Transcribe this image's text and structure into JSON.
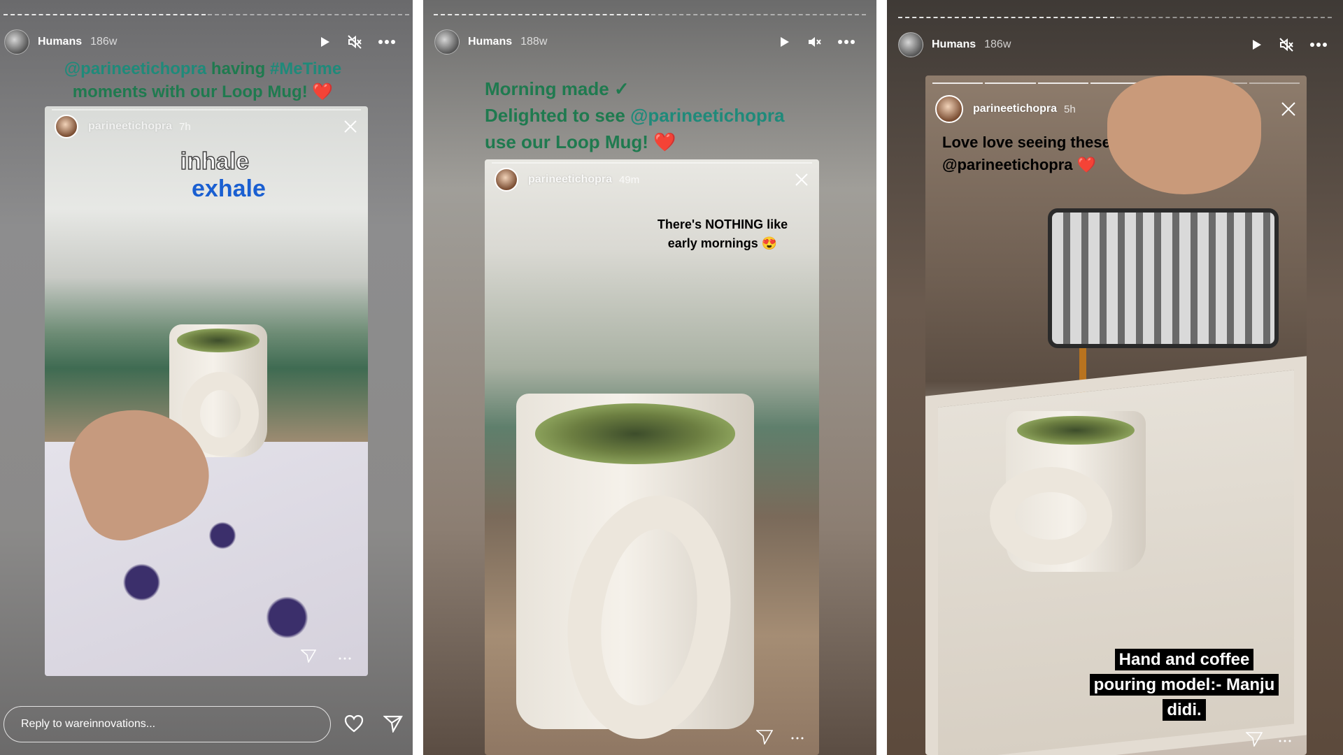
{
  "stories": [
    {
      "header": {
        "name": "Humans",
        "time": "186w"
      },
      "caption": {
        "mention": "@parineetichopra",
        "text1": " having ",
        "hashtag": "#MeTime",
        "line2": "moments with our Loop Mug! ❤️"
      },
      "card": {
        "username": "parineetichopra",
        "time": "7h",
        "sticker_top": "inhale",
        "sticker_bottom": "exhale"
      },
      "reply": {
        "placeholder": "Reply to wareinnovations..."
      }
    },
    {
      "header": {
        "name": "Humans",
        "time": "188w"
      },
      "caption": {
        "line1": "Morning made ✓",
        "line2a": "Delighted to see ",
        "mention": "@parineetichopra",
        "line3": "use our Loop Mug! ❤️"
      },
      "card": {
        "username": "parineetichopra",
        "time": "49m",
        "text1": "There's NOTHING like",
        "text2": "early mornings 😍"
      }
    },
    {
      "header": {
        "name": "Humans",
        "time": "186w"
      },
      "card": {
        "username": "parineetichopra",
        "time": "5h",
        "text1": "Love love seeing these! 😍",
        "text2": "@parineetichopra ❤️",
        "overlay1": "Hand and coffee",
        "overlay2": "pouring model:- Manju",
        "overlay3": "didi."
      }
    }
  ],
  "icons": [
    "play-icon",
    "mute-icon",
    "more-icon",
    "close-icon",
    "send-icon",
    "heart-icon"
  ]
}
